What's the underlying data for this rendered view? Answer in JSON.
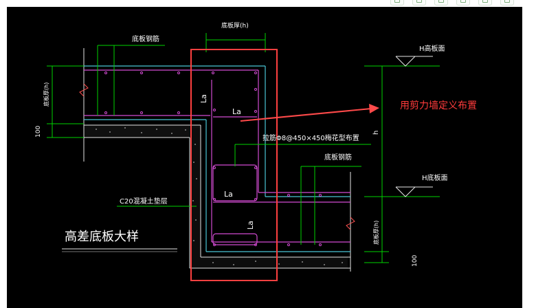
{
  "labels": {
    "thickness_top": "底板厚(h)",
    "rebar_top": "底板钢筋",
    "thickness_left": "底板厚(h)",
    "dim_100_left": "100",
    "h_top": "H高板面",
    "la1": "La",
    "la2": "La",
    "la3": "La",
    "la4": "La",
    "h_dim": "h",
    "tie_bar": "拉筋Φ8@450×450梅花型布置",
    "rebar_bottom": "底板钢筋",
    "h_bottom": "H底板面",
    "cushion": "C20混凝土垫层",
    "title": "高差底板大样",
    "thickness_right": "底板厚(h)",
    "dim_100_right": "100"
  },
  "annotation": "用剪力墙定义布置",
  "colors": {
    "background": "#000000",
    "green": "#00d400",
    "white": "#ffffff",
    "magenta": "#d24bd2",
    "cyan": "#49c6d6",
    "red_box": "#ff4040",
    "arrow": "#ff4a4a",
    "orange": "#ff9a3a"
  }
}
